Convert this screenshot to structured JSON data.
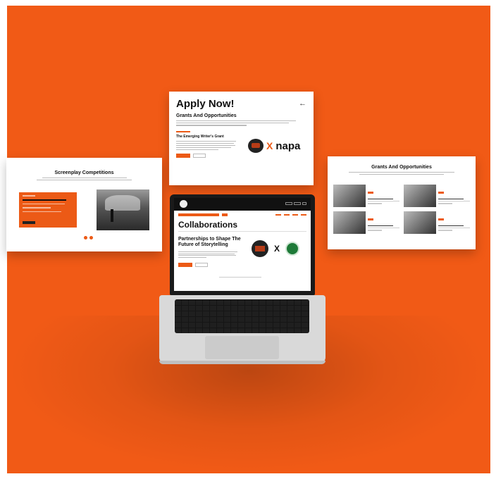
{
  "background": {
    "frame_color": "#ffffff",
    "stage_color": "#f15a16",
    "accent": "#ec5a16"
  },
  "apply_panel": {
    "title": "Apply Now!",
    "back_icon": "arrow-left-icon",
    "section_title": "Grants And Opportunities",
    "intro": "",
    "grant_title": "The Emerging Writer's Grant",
    "partner_x": "X",
    "partner_name": "napa"
  },
  "screenplay_panel": {
    "title": "Screenplay Competitions",
    "card_title": "",
    "carousel_dots": 2
  },
  "grants_panel": {
    "title": "Grants And Opportunities",
    "items": [
      {
        "title": ""
      },
      {
        "title": ""
      },
      {
        "title": ""
      },
      {
        "title": ""
      }
    ]
  },
  "laptop_screen": {
    "page_title": "Collaborations",
    "heading": "Partnerships to Shape The Future of Storytelling",
    "partner_x": "X"
  }
}
